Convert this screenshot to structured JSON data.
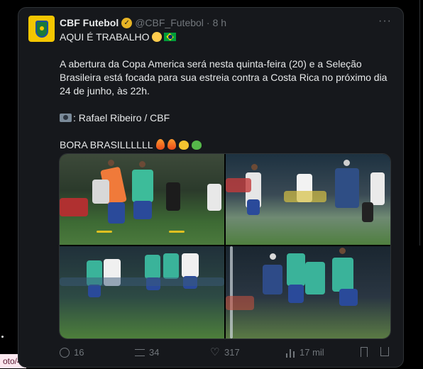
{
  "tweet": {
    "author_name": "CBF Futebol",
    "author_handle": "@CBF_Futebol",
    "separator": "·",
    "time": "8 h",
    "more_label": "···",
    "lines": [
      "AQUI É TRABALHO",
      "A abertura da Copa America será nesta quinta-feira (20) e a Seleção Brasileira está focada para sua estreia contra a Costa Rica no próximo dia 24 de junho, às 22h.",
      ": Rafael Ribeiro / CBF",
      "BORA BRASILLLLLL"
    ],
    "avatar_icon": "cbf-crest-icon",
    "verified_icon": "verified-badge-icon"
  },
  "media": {
    "photos": [
      {
        "alt": "training-photo-1"
      },
      {
        "alt": "training-photo-2"
      },
      {
        "alt": "training-photo-3"
      },
      {
        "alt": "training-photo-4"
      }
    ]
  },
  "actions": {
    "replies": "16",
    "retweets": "34",
    "likes": "317",
    "views": "17 mil"
  },
  "status_url": "oto/4",
  "colors": {
    "background": "#000000",
    "card": "#16181c",
    "text": "#e7e9ea",
    "muted": "#71767b",
    "avatar_yellow": "#f4c600"
  }
}
